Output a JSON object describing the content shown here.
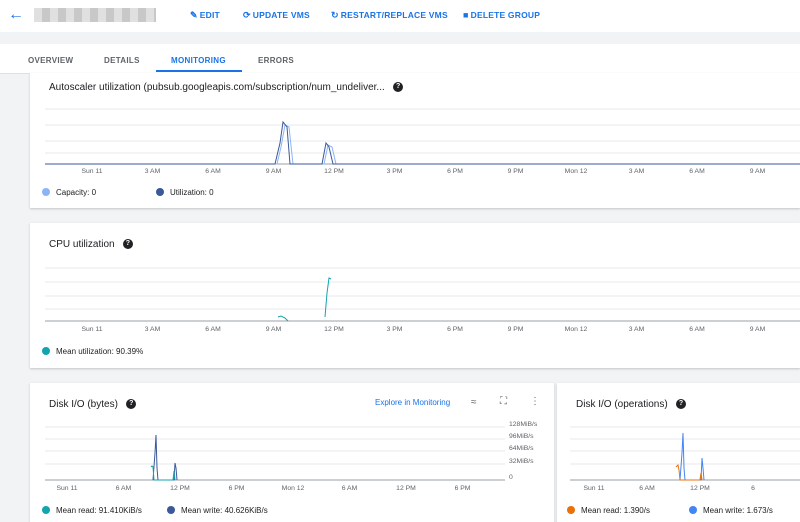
{
  "header": {
    "back_icon": "arrow-back-icon",
    "actions": [
      {
        "label": "EDIT",
        "icon": "pencil-icon"
      },
      {
        "label": "UPDATE VMS",
        "icon": "sync-icon"
      },
      {
        "label": "RESTART/REPLACE VMS",
        "icon": "restart-icon"
      },
      {
        "label": "DELETE GROUP",
        "icon": "trash-icon"
      }
    ]
  },
  "tabs": [
    "OVERVIEW",
    "DETAILS",
    "MONITORING",
    "ERRORS"
  ],
  "active_tab": "MONITORING",
  "autoscaler": {
    "title": "Autoscaler utilization (pubsub.googleapis.com/subscription/num_undeliver...",
    "ticks": [
      "Sun 11",
      "3 AM",
      "6 AM",
      "9 AM",
      "12 PM",
      "3 PM",
      "6 PM",
      "9 PM",
      "Mon 12",
      "3 AM",
      "6 AM",
      "9 AM"
    ],
    "legend": [
      {
        "label": "Capacity:",
        "value": "0",
        "color": "#8ab4f8"
      },
      {
        "label": "Utilization:",
        "value": "0",
        "color": "#3b5998"
      }
    ]
  },
  "cpu": {
    "title": "CPU utilization",
    "ticks": [
      "Sun 11",
      "3 AM",
      "6 AM",
      "9 AM",
      "12 PM",
      "3 PM",
      "6 PM",
      "9 PM",
      "Mon 12",
      "3 AM",
      "6 AM",
      "9 AM"
    ],
    "legend": [
      {
        "label": "Mean utilization:",
        "value": "90.39%",
        "color": "#12a4af"
      }
    ]
  },
  "disk_bytes": {
    "title": "Disk I/O (bytes)",
    "explore_label": "Explore in Monitoring",
    "yticks": [
      "128MiB/s",
      "96MiB/s",
      "64MiB/s",
      "32MiB/s",
      "0"
    ],
    "ticks": [
      "Sun 11",
      "6 AM",
      "12 PM",
      "6 PM",
      "Mon 12",
      "6 AM",
      "12 PM",
      "6 PM"
    ],
    "legend": [
      {
        "label": "Mean read:",
        "value": "91.410KiB/s",
        "color": "#12a4af"
      },
      {
        "label": "Mean write:",
        "value": "40.626KiB/s",
        "color": "#3b5998"
      }
    ]
  },
  "disk_ops": {
    "title": "Disk I/O (operations)",
    "ticks": [
      "Sun 11",
      "6 AM",
      "12 PM",
      "6"
    ],
    "legend": [
      {
        "label": "Mean read:",
        "value": "1.390/s",
        "color": "#e8710a"
      },
      {
        "label": "Mean write:",
        "value": "1.673/s",
        "color": "#4285f4"
      }
    ]
  }
}
